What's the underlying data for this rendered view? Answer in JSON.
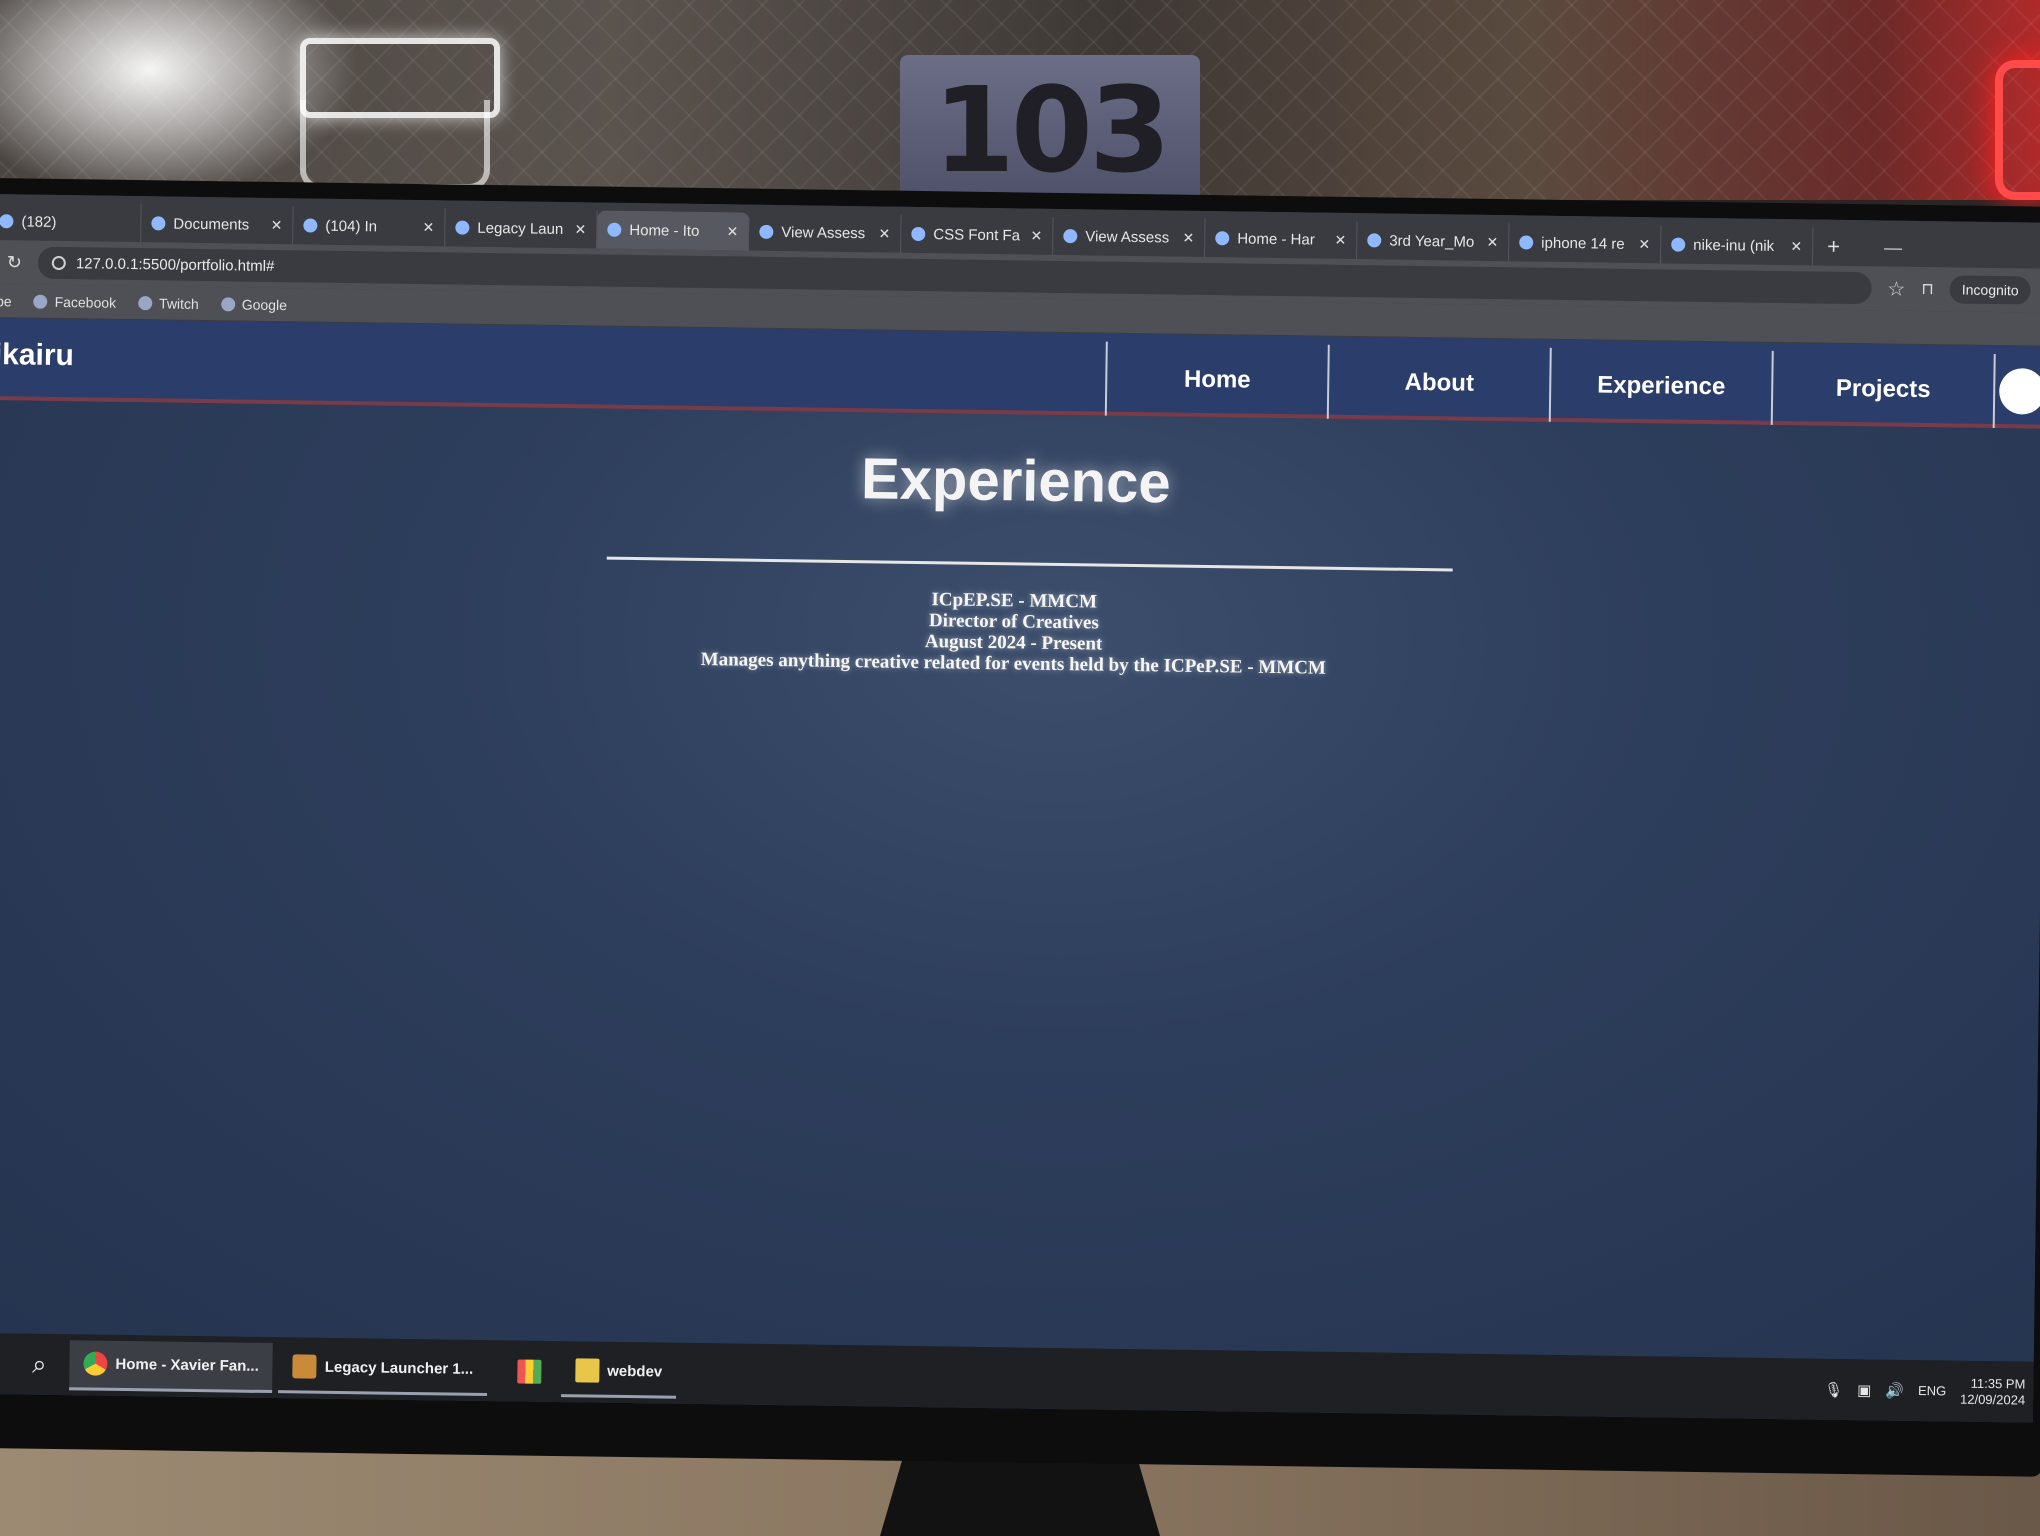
{
  "room": {
    "door_number": "103"
  },
  "browser": {
    "tabs": [
      {
        "title": "(182)",
        "active": false
      },
      {
        "title": "Documents",
        "active": false
      },
      {
        "title": "(104) In",
        "active": false
      },
      {
        "title": "Legacy Laun",
        "active": false
      },
      {
        "title": "Home - Ito",
        "active": true
      },
      {
        "title": "View Assess",
        "active": false
      },
      {
        "title": "CSS Font Fa",
        "active": false
      },
      {
        "title": "View Assess",
        "active": false
      },
      {
        "title": "Home - Har",
        "active": false
      },
      {
        "title": "3rd Year_Mo",
        "active": false
      },
      {
        "title": "iphone 14 re",
        "active": false
      },
      {
        "title": "nike-inu (nik",
        "active": false
      }
    ],
    "tab_close_glyph": "✕",
    "new_tab_glyph": "+",
    "minimize_glyph": "—",
    "reload_glyph": "↻",
    "url": "127.0.0.1:5500/portfolio.html#",
    "star_glyph": "☆",
    "extensions_glyph": "⊓",
    "profile_label": "Incognito",
    "bookmarks": [
      {
        "label": "ube"
      },
      {
        "label": "Facebook"
      },
      {
        "label": "Twitch"
      },
      {
        "label": "Google"
      }
    ]
  },
  "site": {
    "logo": "nikairu",
    "nav": [
      {
        "label": "Home"
      },
      {
        "label": "About"
      },
      {
        "label": "Experience"
      },
      {
        "label": "Projects"
      }
    ],
    "section_title": "Experience",
    "experience": {
      "organization": "ICpEP.SE - MMCM",
      "role": "Director of Creatives",
      "period": "August 2024 - Present",
      "description": "Manages anything creative related for events held by the ICPeP.SE - MMCM"
    }
  },
  "taskbar": {
    "search_glyph": "⌕",
    "apps": [
      {
        "label": "Home - Xavier Fan...",
        "icon": "chrome-icon",
        "active": true
      },
      {
        "label": "Legacy Launcher 1...",
        "icon": "box-icon",
        "active": false
      },
      {
        "label": "",
        "icon": "grid-icon",
        "active": false
      },
      {
        "label": "webdev",
        "icon": "file-icon",
        "active": false
      }
    ],
    "language": "ENG",
    "time": "11:35 PM",
    "date": "12/09/2024"
  }
}
